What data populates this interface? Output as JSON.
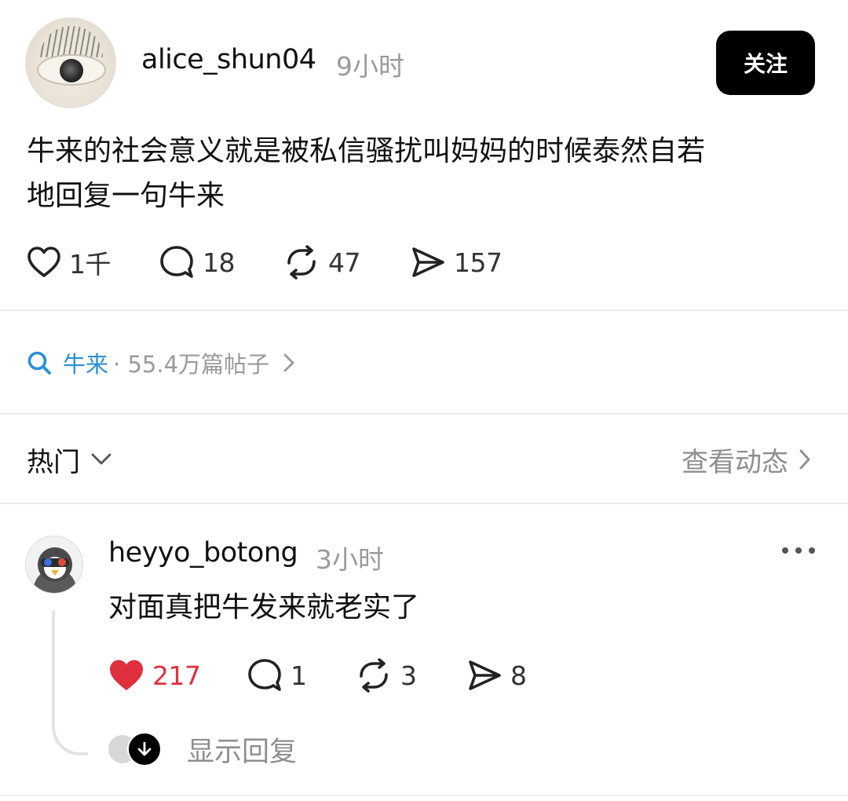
{
  "post": {
    "username": "alice_shun04",
    "time": "9小时",
    "follow_label": "关注",
    "body_line1": "牛来的社会意义就是被私信骚扰叫妈妈的时候泰然自若",
    "body_line2": "地回复一句牛来",
    "stats": {
      "likes": "1千",
      "comments": "18",
      "reposts": "47",
      "shares": "157"
    }
  },
  "topic": {
    "tag": "牛来",
    "meta": "· 55.4万篇帖子"
  },
  "sort": {
    "label": "热门",
    "activity_link": "查看动态"
  },
  "comment": {
    "username": "heyyo_botong",
    "time": "3小时",
    "text": "对面真把牛发来就老实了",
    "stats": {
      "likes": "217",
      "comments": "1",
      "reposts": "3",
      "shares": "8"
    },
    "liked": true,
    "show_replies": "显示回复"
  },
  "colors": {
    "like_red": "#e0303e",
    "topic_blue": "#2a91d4",
    "muted": "#9a9a9a"
  }
}
